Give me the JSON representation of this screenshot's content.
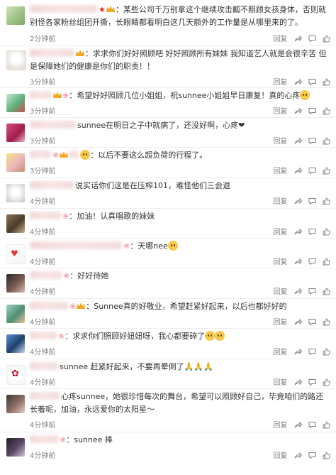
{
  "actions": {
    "reply_label": "回复",
    "share_icon": "share-icon",
    "comment_icon": "comment-icon",
    "like_icon": "thumbs-up-icon"
  },
  "comments": [
    {
      "text": "：某些公司千万别拿这个继续攻击瓤不照顾女孩身体，否则就别怪各家粉丝组团开撕，长眼睛都看明白这几天额外的工作量是从哪里来的了。",
      "time": "2分钟前"
    },
    {
      "text": "：求求你们好好照顾吧 好好照顾所有妹妹 我知道艺人就是会很辛苦 但是保障她们的健康是你们的职责！！",
      "time": "3分钟前"
    },
    {
      "text": "：希望好好照顾几位小姐姐，祝sunnee小姐姐早日康复！真的心疼",
      "time": "3分钟前"
    },
    {
      "text": "sunnee在明日之子中就病了，还没好啊，心疼❤",
      "time": "3分钟前"
    },
    {
      "text": "：以后不要这么超负荷的行程了。",
      "time": "3分钟前"
    },
    {
      "text": "说实话你们这是在压榨101，难怪他们三会退",
      "time": "4分钟前"
    },
    {
      "text": "：加油！认真唱歌的妹妹",
      "time": "4分钟前"
    },
    {
      "text": "：天哪nee",
      "time": "4分钟前"
    },
    {
      "text": "：好好待她",
      "time": "4分钟前"
    },
    {
      "text": "：Sunnee真的好敬业，希望赶紧好起来，以后也都好好的",
      "time": "4分钟前"
    },
    {
      "text": "：求求你们照顾好妞妞呀，我心都要碎了",
      "time": "4分钟前"
    },
    {
      "text": "sunnee 赶紧好起来，不要再晕倒了🙏🙏🙏",
      "time": "4分钟前"
    },
    {
      "text": "心疼sunnee，她很珍惜每次的舞台，希望可以照顾好自己，毕竟咱们的路还长着呢，加油，永远爱你的太阳星～",
      "time": "4分钟前"
    },
    {
      "text": "：sunnee 棒",
      "time": "4分钟前"
    }
  ]
}
